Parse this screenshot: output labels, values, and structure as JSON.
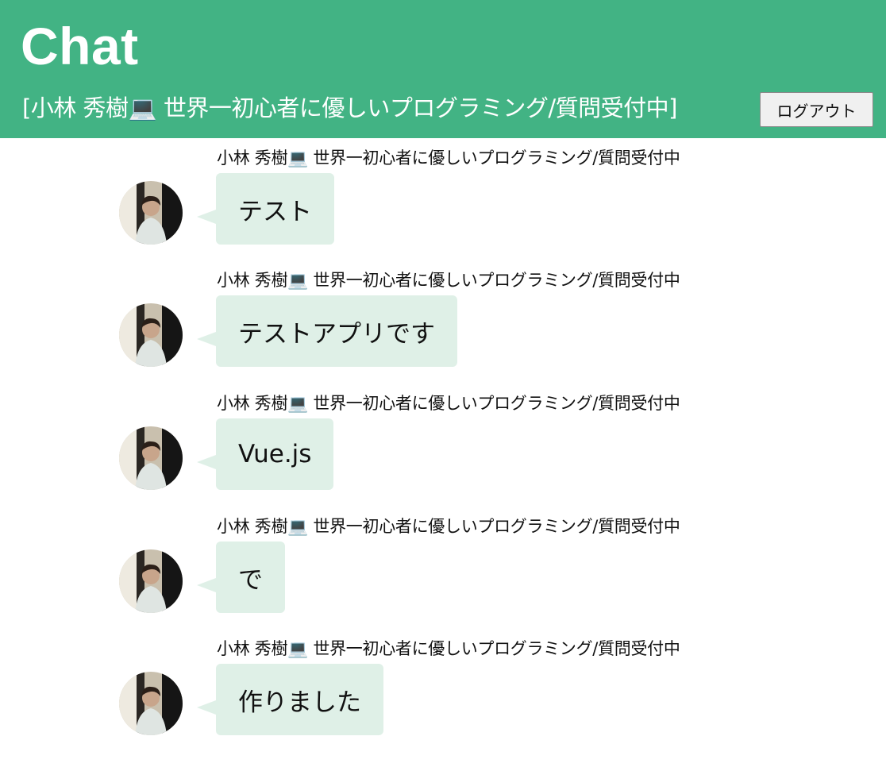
{
  "header": {
    "title": "Chat",
    "current_user": "[小林 秀樹💻 世界一初心者に優しいプログラミング/質問受付中]",
    "logout_label": "ログアウト"
  },
  "messages": [
    {
      "sender": "小林 秀樹💻 世界一初心者に優しいプログラミング/質問受付中",
      "text": "テスト"
    },
    {
      "sender": "小林 秀樹💻 世界一初心者に優しいプログラミング/質問受付中",
      "text": "テストアプリです"
    },
    {
      "sender": "小林 秀樹💻 世界一初心者に優しいプログラミング/質問受付中",
      "text": "Vue.js"
    },
    {
      "sender": "小林 秀樹💻 世界一初心者に優しいプログラミング/質問受付中",
      "text": "で"
    },
    {
      "sender": "小林 秀樹💻 世界一初心者に優しいプログラミング/質問受付中",
      "text": "作りました"
    }
  ],
  "colors": {
    "header_background": "#42b384",
    "bubble_background": "#dff0e7",
    "header_text": "#ffffff"
  },
  "icons": {
    "avatar": "user-photo-avatar"
  }
}
